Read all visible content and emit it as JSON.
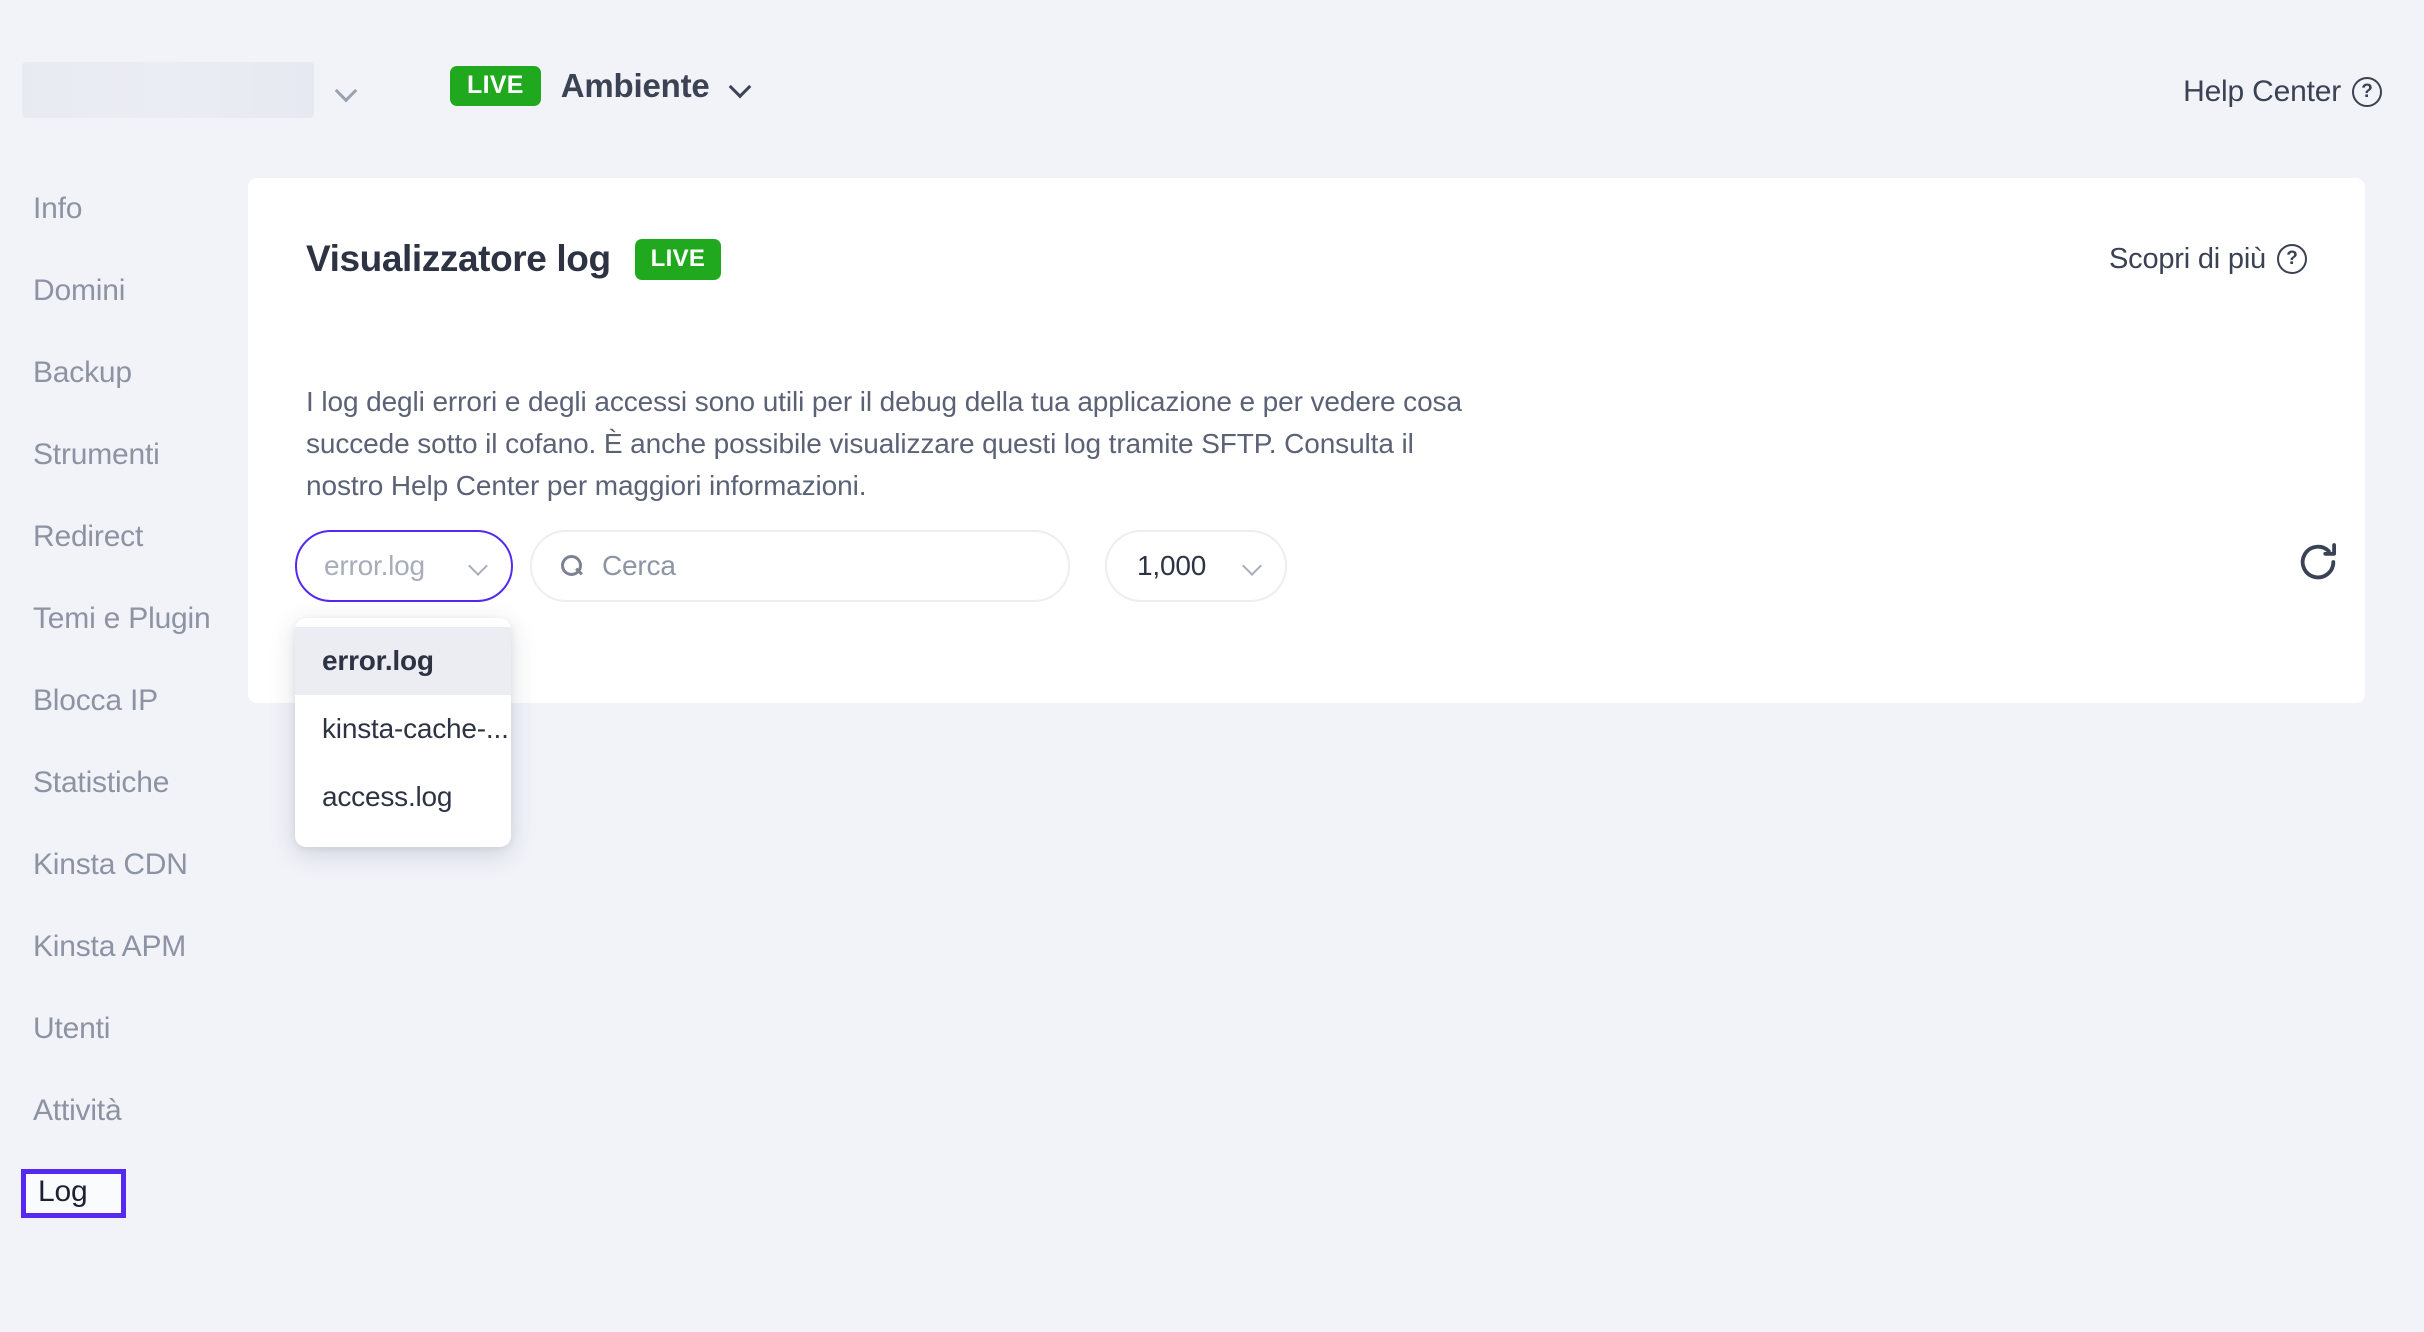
{
  "topbar": {
    "site_selector_placeholder": "",
    "env_badge": "LIVE",
    "env_label": "Ambiente",
    "help_center": "Help Center"
  },
  "sidebar": {
    "items": [
      {
        "label": "Info",
        "active": false
      },
      {
        "label": "Domini",
        "active": false
      },
      {
        "label": "Backup",
        "active": false
      },
      {
        "label": "Strumenti",
        "active": false
      },
      {
        "label": "Redirect",
        "active": false
      },
      {
        "label": "Temi e Plugin",
        "active": false
      },
      {
        "label": "Blocca IP",
        "active": false
      },
      {
        "label": "Statistiche",
        "active": false
      },
      {
        "label": "Kinsta CDN",
        "active": false
      },
      {
        "label": "Kinsta APM",
        "active": false
      },
      {
        "label": "Utenti",
        "active": false
      },
      {
        "label": "Attività",
        "active": false
      },
      {
        "label": "Log",
        "active": true
      }
    ]
  },
  "card": {
    "title": "Visualizzatore log",
    "badge": "LIVE",
    "discover_link": "Scopri di più",
    "description": "I log degli errori e degli accessi sono utili per il debug della tua applicazione e per vedere cosa succede sotto il cofano. È anche possibile visualizzare questi log tramite SFTP. Consulta il nostro Help Center per maggiori informazioni."
  },
  "controls": {
    "log_select_value": "error.log",
    "search_placeholder": "Cerca",
    "lines_select_value": "1,000",
    "refresh_label": "refresh-icon"
  },
  "dropdown": {
    "options": [
      {
        "label": "error.log",
        "selected": true
      },
      {
        "label": "kinsta-cache-...",
        "selected": false
      },
      {
        "label": "access.log",
        "selected": false
      }
    ]
  },
  "colors": {
    "accent_purple": "#5429f0",
    "live_green": "#20a91e",
    "page_bg": "#f1f3f9",
    "card_bg": "#ffffff",
    "text_dark": "#2d3343",
    "text_muted": "#8d93a3"
  }
}
